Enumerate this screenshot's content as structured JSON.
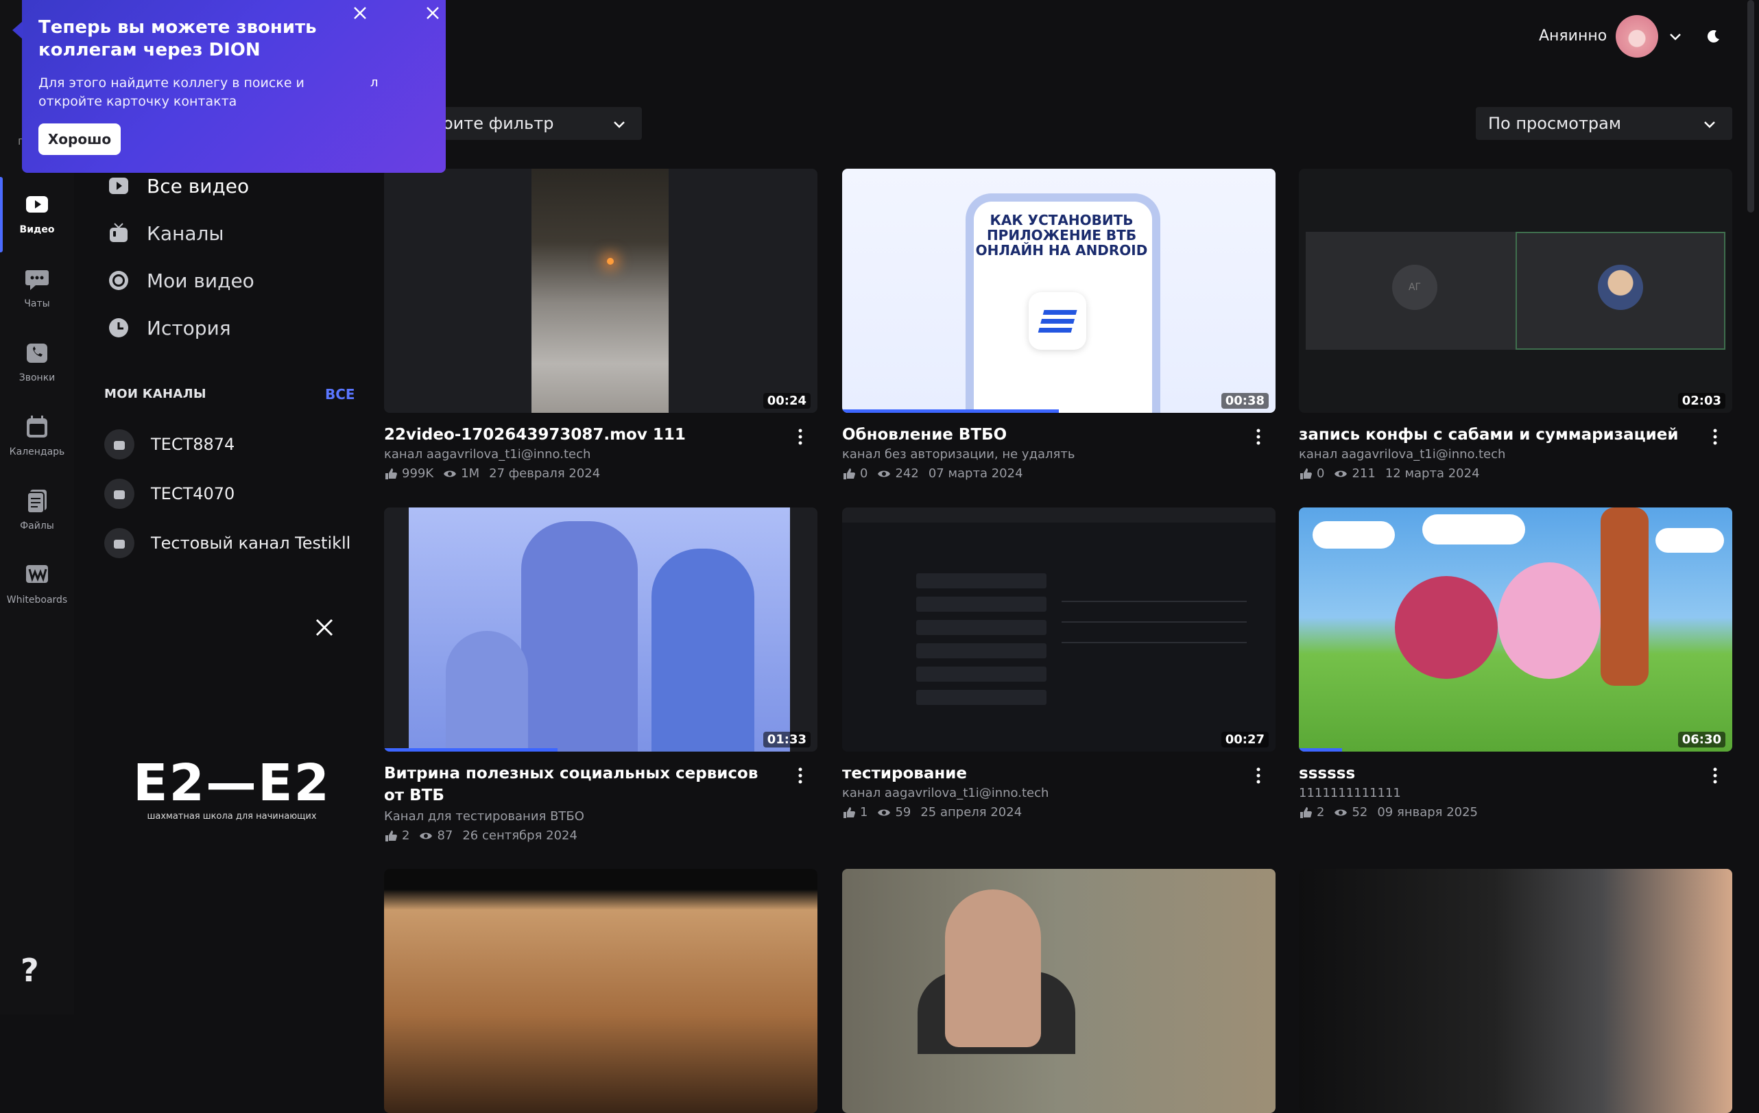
{
  "app": {
    "user_name": "Аняинно"
  },
  "popup": {
    "title": "Теперь вы можете звонить коллегам через DION",
    "text": "Для этого найдите коллегу в поиске и откройте карточку контакта",
    "ok_label": "Хорошо",
    "caret_text": "л"
  },
  "rail": {
    "items": [
      {
        "label": "Видео",
        "icon": "video-icon"
      },
      {
        "label": "Чаты",
        "icon": "chat-icon"
      },
      {
        "label": "Звонки",
        "icon": "phone-icon"
      },
      {
        "label": "Календарь",
        "icon": "calendar-icon"
      },
      {
        "label": "Файлы",
        "icon": "files-icon"
      },
      {
        "label": "Whiteboards",
        "icon": "whiteboard-icon"
      }
    ],
    "help": "?",
    "partial_label": "г"
  },
  "nav": {
    "items": [
      {
        "label": "Все видео",
        "icon": "play-icon"
      },
      {
        "label": "Каналы",
        "icon": "tv-icon"
      },
      {
        "label": "Мои видео",
        "icon": "record-icon"
      },
      {
        "label": "История",
        "icon": "clock-icon"
      }
    ],
    "my_channels_title": "МОИ КАНАЛЫ",
    "all_link": "ВСЕ",
    "channels": [
      "ТЕСТ8874",
      "ТЕСТ4070",
      "Тестовый канал Testikll"
    ]
  },
  "promo": {
    "logo_text": "E2—E2",
    "logo_sub": "шахматная школа для начинающих"
  },
  "filters": {
    "filter_label": "оите фильтр",
    "sort_label": "По просмотрам"
  },
  "videos": [
    {
      "title": "22video-1702643973087.mov 111",
      "channel": "канал aagavrilova_t1i@inno.tech",
      "likes": "999K",
      "views": "1M",
      "date": "27 февраля 2024",
      "duration": "00:24",
      "progress": 0
    },
    {
      "title": "Обновление ВТБО",
      "channel": "канал без авторизации, не удалять",
      "likes": "0",
      "views": "242",
      "date": "07 марта 2024",
      "duration": "00:38",
      "progress": 0.5,
      "thumb_text": "КАК УСТАНОВИТЬ ПРИЛОЖЕНИЕ ВТБ ОНЛАЙН НА ANDROID"
    },
    {
      "title": "запись конфы с сабами и суммаризацией",
      "channel": "канал aagavrilova_t1i@inno.tech",
      "likes": "0",
      "views": "211",
      "date": "12 марта 2024",
      "duration": "02:03",
      "progress": 0
    },
    {
      "title": "Витрина полезных социальных сервисов от ВТБ",
      "channel": "Канал для тестирования ВТБО",
      "likes": "2",
      "views": "87",
      "date": "26 сентября 2024",
      "duration": "01:33",
      "progress": 0.4
    },
    {
      "title": "тестирование",
      "channel": "канал aagavrilova_t1i@inno.tech",
      "likes": "1",
      "views": "59",
      "date": "25 апреля 2024",
      "duration": "00:27",
      "progress": 0
    },
    {
      "title": "ssssss",
      "channel": "1111111111111",
      "likes": "2",
      "views": "52",
      "date": "09 января 2025",
      "duration": "06:30",
      "progress": 0.1
    }
  ]
}
